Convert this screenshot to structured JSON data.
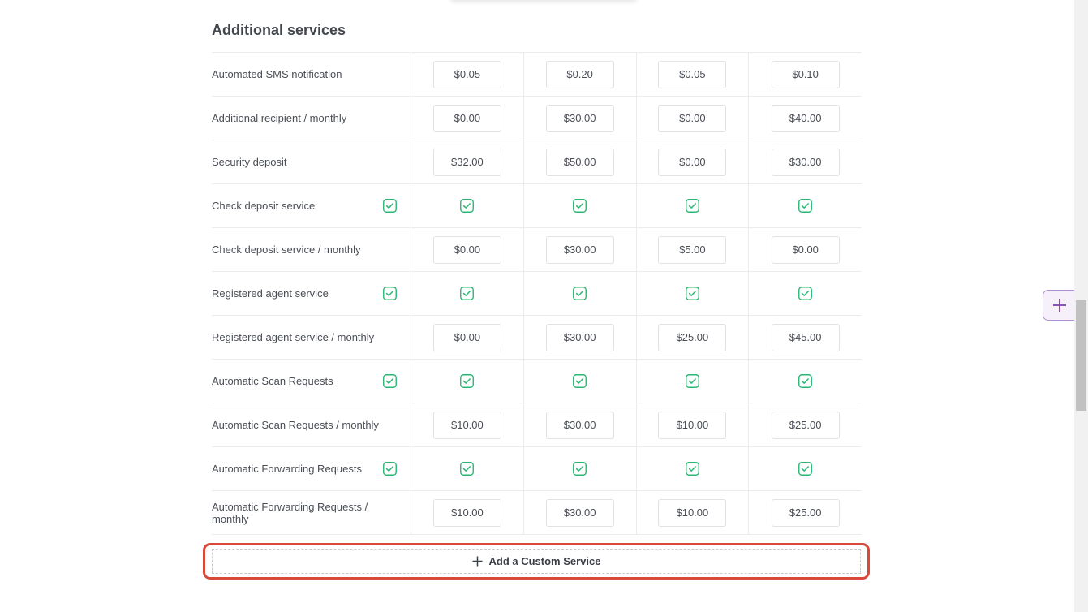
{
  "section": {
    "title": "Additional services"
  },
  "rows": [
    {
      "label": "Automated SMS notification",
      "type": "price",
      "values": [
        "$0.05",
        "$0.20",
        "$0.05",
        "$0.10"
      ]
    },
    {
      "label": "Additional recipient / monthly",
      "type": "price",
      "values": [
        "$0.00",
        "$30.00",
        "$0.00",
        "$40.00"
      ]
    },
    {
      "label": "Security deposit",
      "type": "price",
      "values": [
        "$32.00",
        "$50.00",
        "$0.00",
        "$30.00"
      ]
    },
    {
      "label": "Check deposit service",
      "type": "check",
      "master": true,
      "values": [
        true,
        true,
        true,
        true
      ]
    },
    {
      "label": "Check deposit service / monthly",
      "type": "price",
      "values": [
        "$0.00",
        "$30.00",
        "$5.00",
        "$0.00"
      ]
    },
    {
      "label": "Registered agent service",
      "type": "check",
      "master": true,
      "values": [
        true,
        true,
        true,
        true
      ]
    },
    {
      "label": "Registered agent service / monthly",
      "type": "price",
      "values": [
        "$0.00",
        "$30.00",
        "$25.00",
        "$45.00"
      ]
    },
    {
      "label": "Automatic Scan Requests",
      "type": "check",
      "master": true,
      "values": [
        true,
        true,
        true,
        true
      ]
    },
    {
      "label": "Automatic Scan Requests / monthly",
      "type": "price",
      "values": [
        "$10.00",
        "$30.00",
        "$10.00",
        "$25.00"
      ]
    },
    {
      "label": "Automatic Forwarding Requests",
      "type": "check",
      "master": true,
      "values": [
        true,
        true,
        true,
        true
      ]
    },
    {
      "label": "Automatic Forwarding Requests / monthly",
      "type": "price",
      "values": [
        "$10.00",
        "$30.00",
        "$10.00",
        "$25.00"
      ]
    }
  ],
  "add_custom_service": {
    "label": "Add a Custom Service",
    "icon": "plus-icon"
  },
  "colors": {
    "check": "#2bb673",
    "highlight": "#d9493a",
    "accent": "#7b3fa8"
  }
}
